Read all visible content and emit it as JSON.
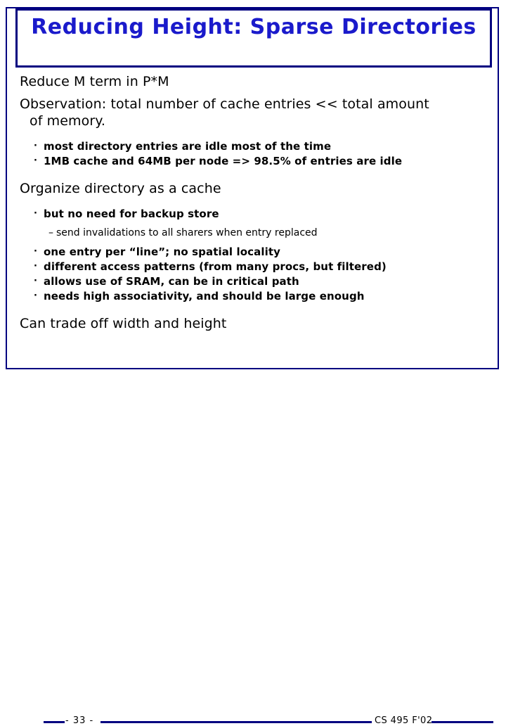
{
  "slide": {
    "title": "Reducing Height: Sparse Directories",
    "colors": {
      "title_blue": "#1a1acb",
      "frame_navy": "#000080",
      "text_black": "#000000",
      "background": "#ffffff"
    },
    "body": {
      "line_reduce": "Reduce M term in P*M",
      "line_observation_a": "Observation: total number of cache entries << total amount",
      "line_observation_b": "of memory.",
      "sub_most_directory": "most directory entries are idle most of the time",
      "sub_1mb_cache": "1MB cache and 64MB per node => 98.5% of entries are idle",
      "line_organize": "Organize directory as a cache",
      "sub_backup_store": "but no need for backup store",
      "sub_sub_invalidations": "send invalidations to all sharers when entry replaced",
      "sub_one_entry": "one entry per “line”; no spatial locality",
      "sub_access_patterns": "different access patterns (from many procs, but filtered)",
      "sub_sram": "allows use of SRAM, can be in critical path",
      "sub_associativity": "needs high associativity, and should be large enough",
      "line_trade_off": "Can trade off width and height"
    },
    "markers": {
      "bullet_dot": "·",
      "dash": "–"
    },
    "footer": {
      "page_number": "- 33 -",
      "course": "CS 495 F'02"
    }
  }
}
